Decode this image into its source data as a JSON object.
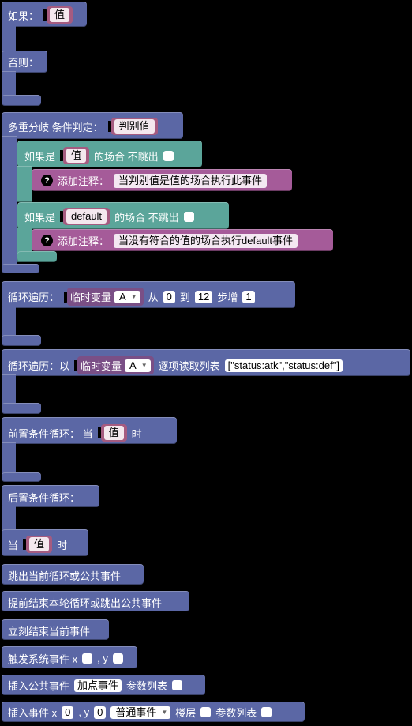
{
  "if_block": {
    "if_label": "如果：",
    "value": "值",
    "else_label": "否则："
  },
  "switch_block": {
    "label": "多重分歧 条件判定：",
    "value": "判别值",
    "case1": {
      "if_label": "如果是",
      "value": "值",
      "suffix": "的场合 不跳出",
      "note_label": "添加注释：",
      "note_text": "当判别值是值的场合执行此事件"
    },
    "case2": {
      "if_label": "如果是",
      "value": "default",
      "suffix": "的场合 不跳出",
      "note_label": "添加注释：",
      "note_text": "当没有符合的值的场合执行default事件"
    }
  },
  "for_block": {
    "label": "循环遍历：",
    "var_label": "临时变量",
    "var": "A",
    "from": "从",
    "start": "0",
    "to": "到",
    "end": "12",
    "step_label": "步增",
    "step": "1"
  },
  "foreach_block": {
    "label": "循环遍历：以",
    "var_label": "临时变量",
    "var": "A",
    "list_label": "逐项读取列表",
    "list": "[\"status:atk\",\"status:def\"]"
  },
  "while_block": {
    "label": "前置条件循环：  当",
    "value": "值",
    "suffix": "时"
  },
  "dowhile_block": {
    "label": "后置条件循环：",
    "when": "当",
    "value": "值",
    "suffix": "时"
  },
  "simple_blocks": {
    "break": "跳出当前循环或公共事件",
    "continue": "提前结束本轮循环或跳出公共事件",
    "exit": "立刻结束当前事件"
  },
  "trigger_block": {
    "label": "触发系统事件 x",
    "y_label": ", y"
  },
  "insert_common": {
    "label": "插入公共事件",
    "event": "加点事件",
    "params_label": "参数列表"
  },
  "insert_event": {
    "label": "插入事件 x",
    "x": "0",
    "y_label": ", y",
    "y": "0",
    "type": "普通事件",
    "floor_label": "楼层",
    "params_label": "参数列表"
  }
}
